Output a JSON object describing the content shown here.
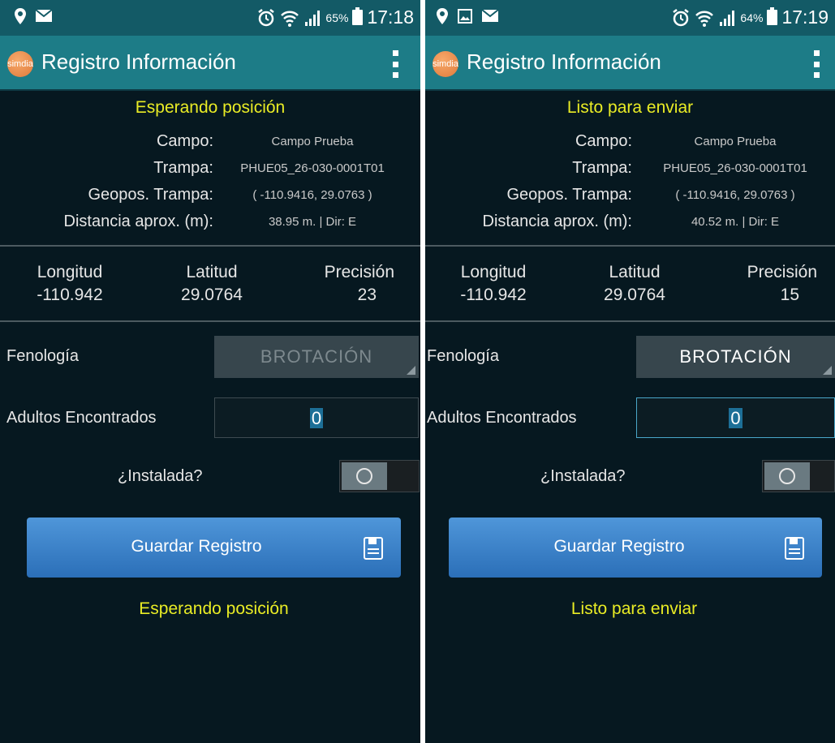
{
  "colors": {
    "status_bar": "#135a66",
    "app_bar": "#1d7c87",
    "background": "#061820",
    "status_text": "#e9ec25",
    "button": "#3a80c7"
  },
  "screens": [
    {
      "status_bar": {
        "icons": [
          "location-pin-icon",
          "email-notification-icon",
          "alarm-icon",
          "wifi-icon",
          "signal-icon",
          "battery-icon"
        ],
        "battery_pct": "65%",
        "time": "17:18"
      },
      "app_bar": {
        "logo_text": "simdia",
        "title": "Registro Información",
        "menu_icon": "overflow-menu-icon"
      },
      "status_top": "Esperando posición",
      "info": [
        {
          "label": "Campo:",
          "value": "Campo Prueba"
        },
        {
          "label": "Trampa:",
          "value": "PHUE05_26-030-0001T01"
        },
        {
          "label": "Geopos. Trampa:",
          "value": "( -110.9416, 29.0763 )"
        },
        {
          "label": "Distancia aprox. (m):",
          "value": "38.95 m. | Dir: E"
        }
      ],
      "coords": {
        "longitud": {
          "label": "Longitud",
          "value": "-110.942"
        },
        "latitud": {
          "label": "Latitud",
          "value": "29.0764"
        },
        "precision": {
          "label": "Precisión",
          "value": "23"
        }
      },
      "fenologia": {
        "label": "Fenología",
        "value": "BROTACIÓN",
        "enabled": false
      },
      "adultos": {
        "label": "Adultos Encontrados",
        "value": "0",
        "focused": false
      },
      "instalada": {
        "label": "¿Instalada?",
        "on": false
      },
      "save_button": {
        "label": "Guardar Registro",
        "icon": "floppy-disk-icon"
      },
      "status_bottom": "Esperando posición"
    },
    {
      "status_bar": {
        "icons": [
          "location-pin-icon",
          "image-notification-icon",
          "email-notification-icon",
          "alarm-icon",
          "wifi-icon",
          "signal-icon",
          "battery-icon"
        ],
        "battery_pct": "64%",
        "time": "17:19"
      },
      "app_bar": {
        "logo_text": "simdia",
        "title": "Registro Información",
        "menu_icon": "overflow-menu-icon"
      },
      "status_top": "Listo para enviar",
      "info": [
        {
          "label": "Campo:",
          "value": "Campo Prueba"
        },
        {
          "label": "Trampa:",
          "value": "PHUE05_26-030-0001T01"
        },
        {
          "label": "Geopos. Trampa:",
          "value": "( -110.9416, 29.0763 )"
        },
        {
          "label": "Distancia aprox. (m):",
          "value": "40.52 m. | Dir: E"
        }
      ],
      "coords": {
        "longitud": {
          "label": "Longitud",
          "value": "-110.942"
        },
        "latitud": {
          "label": "Latitud",
          "value": "29.0764"
        },
        "precision": {
          "label": "Precisión",
          "value": "15"
        }
      },
      "fenologia": {
        "label": "Fenología",
        "value": "BROTACIÓN",
        "enabled": true
      },
      "adultos": {
        "label": "Adultos Encontrados",
        "value": "0",
        "focused": true
      },
      "instalada": {
        "label": "¿Instalada?",
        "on": false
      },
      "save_button": {
        "label": "Guardar Registro",
        "icon": "floppy-disk-icon"
      },
      "status_bottom": "Listo para enviar"
    }
  ]
}
